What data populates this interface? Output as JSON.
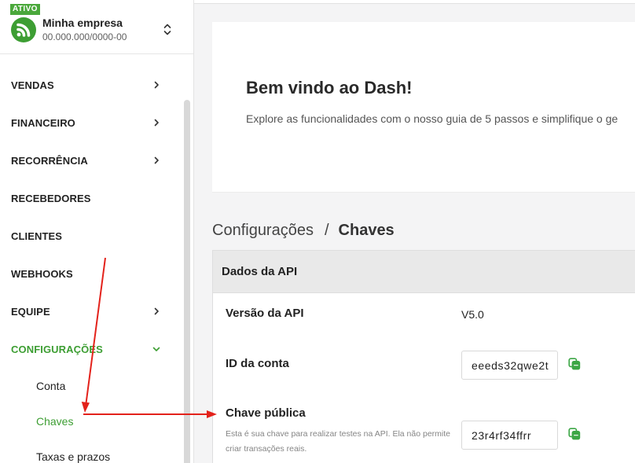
{
  "colors": {
    "accent": "#3d9e33",
    "badge": "#4aa83b",
    "copy_icon": "#3ca646",
    "annotation_arrow": "#e3221b"
  },
  "sidebar": {
    "company": {
      "status_badge": "ATIVO",
      "logo_icon": "company-logo-icon",
      "name": "Minha empresa",
      "document": "00.000.000/0000-00",
      "switcher_icon": "chevron-up-down-icon"
    },
    "menu": [
      {
        "label": "VENDAS",
        "icon": "chevron-right-icon",
        "active": false
      },
      {
        "label": "FINANCEIRO",
        "icon": "chevron-right-icon",
        "active": false
      },
      {
        "label": "RECORRÊNCIA",
        "icon": "chevron-right-icon",
        "active": false
      },
      {
        "label": "RECEBEDORES",
        "active": false
      },
      {
        "label": "CLIENTES",
        "active": false
      },
      {
        "label": "WEBHOOKS",
        "active": false
      },
      {
        "label": "EQUIPE",
        "icon": "chevron-right-icon",
        "active": false
      },
      {
        "label": "CONFIGURAÇÕES",
        "icon": "chevron-down-icon",
        "active": true,
        "expanded": true
      }
    ],
    "submenu": [
      {
        "label": "Conta",
        "active": false
      },
      {
        "label": "Chaves",
        "active": true
      },
      {
        "label": "Taxas e prazos",
        "active": false
      }
    ]
  },
  "welcome": {
    "title": "Bem vindo ao Dash!",
    "text": "Explore as funcionalidades com o nosso guia de 5 passos e simplifique o ge"
  },
  "breadcrumb": {
    "parent": "Configurações",
    "separator": "/",
    "current": "Chaves"
  },
  "api_card": {
    "title": "Dados da API",
    "rows": {
      "version": {
        "label": "Versão da API",
        "value": "V5.0"
      },
      "account_id": {
        "label": "ID da conta",
        "value": "eeeds32qwe2t",
        "action_icon": "copy-icon"
      },
      "public_key": {
        "label": "Chave pública",
        "description": "Esta é sua chave para realizar testes na API. Ela não permite criar transações reais.",
        "value": "23r4rf34ffrr",
        "action_icon": "copy-icon"
      }
    }
  }
}
